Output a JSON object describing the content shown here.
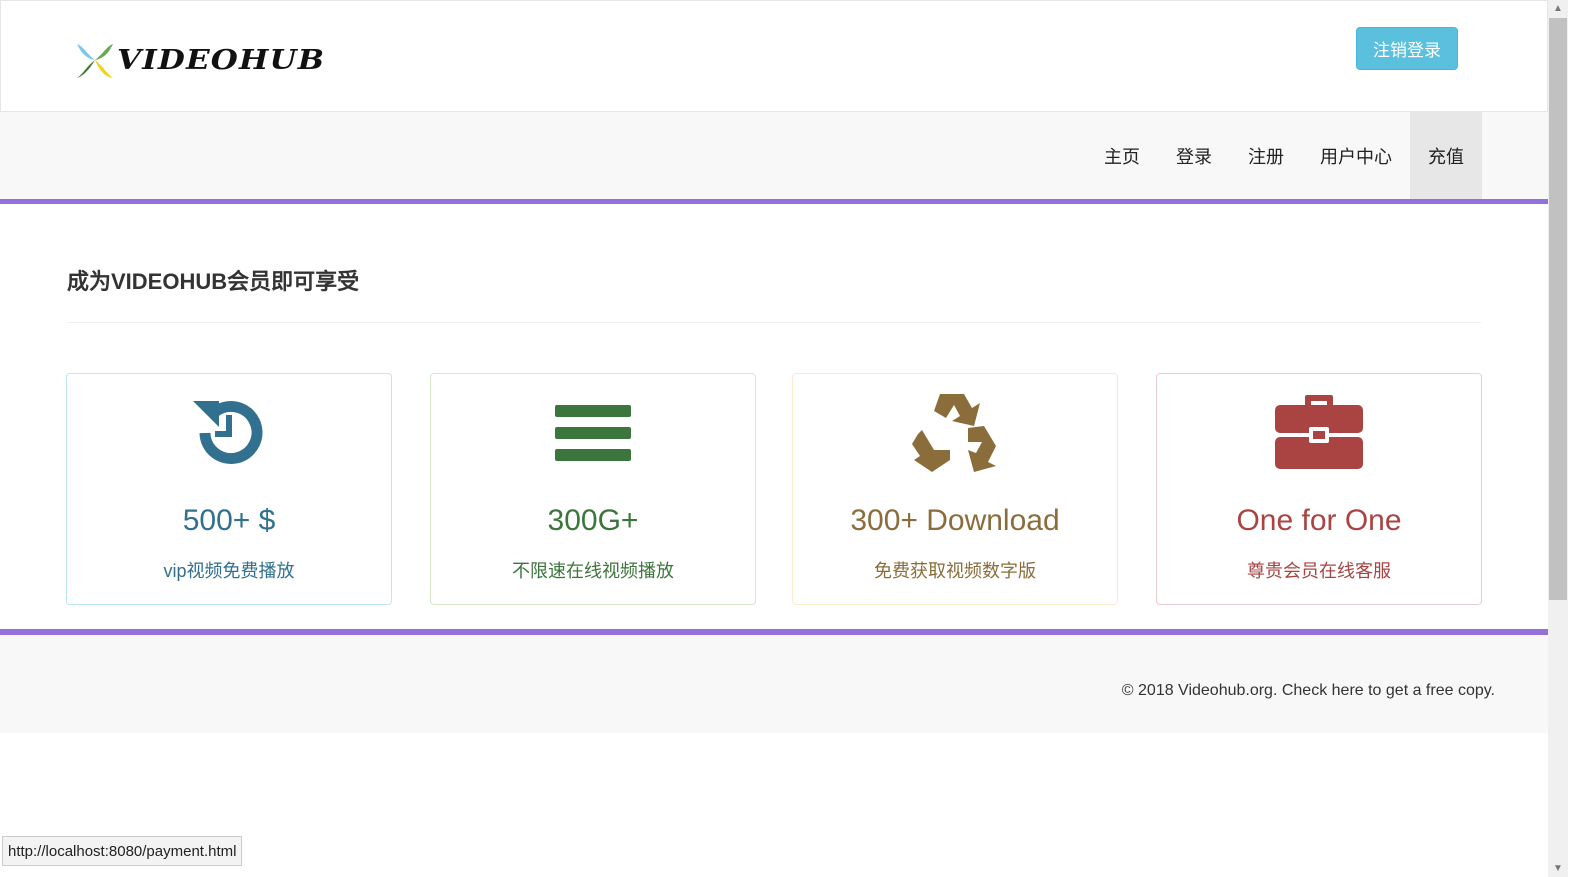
{
  "header": {
    "logo_text": "VIDEOHUB",
    "logout_label": "注销登录"
  },
  "nav": {
    "items": [
      {
        "label": "主页"
      },
      {
        "label": "登录"
      },
      {
        "label": "注册"
      },
      {
        "label": "用户中心"
      },
      {
        "label": "充值"
      }
    ],
    "active": "充值"
  },
  "main": {
    "title": "成为VIDEOHUB会员即可享受",
    "cards": [
      {
        "icon": "history-icon",
        "stat": "500+  $",
        "desc": "vip视频免费播放",
        "color": "#31708f"
      },
      {
        "icon": "menu-bars-icon",
        "stat": "300G+",
        "desc": "不限速在线视频播放",
        "color": "#3c763d"
      },
      {
        "icon": "recycle-icon",
        "stat": "300+ Download",
        "desc": "免费获取视频数字版",
        "color": "#8a6d3b"
      },
      {
        "icon": "briefcase-icon",
        "stat": "One for One",
        "desc": "尊贵会员在线客服",
        "color": "#a94442"
      }
    ]
  },
  "footer": {
    "text": "© 2018 Videohub.org. Check here to get a free copy."
  },
  "statusbar": {
    "url": "http://localhost:8080/payment.html"
  },
  "colors": {
    "accent": "#9370db",
    "button": "#5bc0de"
  }
}
